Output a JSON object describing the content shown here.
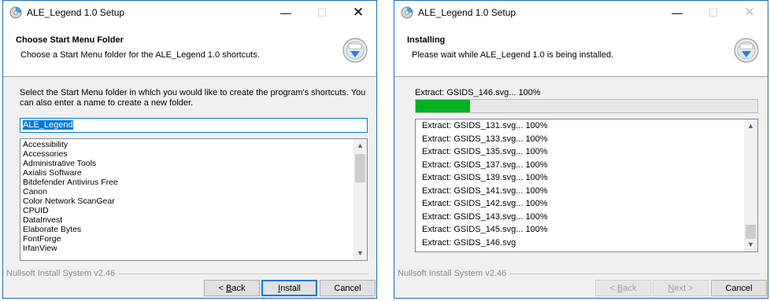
{
  "left_window": {
    "title": "ALE_Legend 1.0 Setup",
    "header_title": "Choose Start Menu Folder",
    "header_subtitle": "Choose a Start Menu folder for the ALE_Legend 1.0 shortcuts.",
    "description": "Select the Start Menu folder in which you would like to create the program's shortcuts. You can also enter a name to create a new folder.",
    "folder_input_value": "ALE_Legend",
    "folders": [
      "Accessibility",
      "Accessories",
      "Administrative Tools",
      "Axialis Software",
      "Bitdefender Antivirus Free",
      "Canon",
      "Color Network ScanGear",
      "CPUID",
      "DataInvest",
      "Elaborate Bytes",
      "FontForge",
      "IrfanView"
    ],
    "brand": "Nullsoft Install System v2.46",
    "buttons": {
      "back_prefix": "< ",
      "back_key": "B",
      "back_rest": "ack",
      "install_key": "I",
      "install_rest": "nstall",
      "cancel": "Cancel"
    }
  },
  "right_window": {
    "title": "ALE_Legend 1.0 Setup",
    "header_title": "Installing",
    "header_subtitle": "Please wait while ALE_Legend 1.0 is being installed.",
    "progress_label": "Extract: GSIDS_146.svg... 100%",
    "progress_fraction": 0.16,
    "log_items": [
      "Extract: GSIDS_131.svg... 100%",
      "Extract: GSIDS_133.svg... 100%",
      "Extract: GSIDS_135.svg... 100%",
      "Extract: GSIDS_137.svg... 100%",
      "Extract: GSIDS_139.svg... 100%",
      "Extract: GSIDS_141.svg... 100%",
      "Extract: GSIDS_142.svg... 100%",
      "Extract: GSIDS_143.svg... 100%",
      "Extract: GSIDS_145.svg... 100%",
      "Extract: GSIDS_146.svg"
    ],
    "brand": "Nullsoft Install System v2.46",
    "buttons": {
      "back_prefix": "< ",
      "back_key": "B",
      "back_rest": "ack",
      "next_key": "N",
      "next_rest": "ext >",
      "cancel": "Cancel"
    }
  },
  "titlebar_glyphs": {
    "minimize": "—",
    "maximize": "☐",
    "close": "✕",
    "scroll_up": "▲",
    "scroll_down": "▼"
  },
  "colors": {
    "accent": "#0078d7",
    "progress": "#06b025",
    "window_border": "#1f6bb5"
  },
  "icons": {
    "app": "installer-cd-icon",
    "header": "nsis-setup-icon"
  }
}
